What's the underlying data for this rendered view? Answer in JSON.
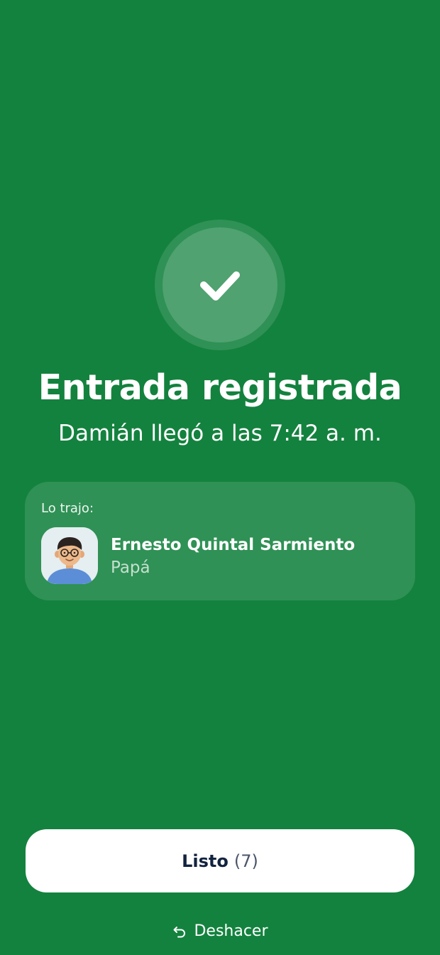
{
  "status": {
    "title": "Entrada registrada",
    "subtitle": "Damián llegó a las 7:42 a. m.",
    "icon": "check-icon"
  },
  "companion_card": {
    "label": "Lo trajo:",
    "name": "Ernesto Quintal Sarmiento",
    "relation": "Papá",
    "avatar_icon": "avatar"
  },
  "actions": {
    "done_label": "Listo",
    "done_count": "(7)",
    "undo_label": "Deshacer",
    "undo_icon": "undo-icon"
  },
  "colors": {
    "background": "#13823E",
    "button_bg": "#FFFFFF",
    "button_text": "#12233F"
  }
}
